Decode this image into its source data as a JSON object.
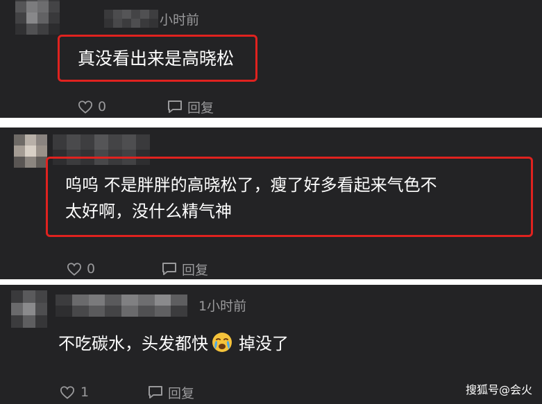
{
  "comments": [
    {
      "time": "小时前",
      "text_lines": [
        "真没看出来是高晓松"
      ],
      "likes": "0",
      "reply_label": "回复"
    },
    {
      "text_lines": [
        "呜呜 不是胖胖的高晓松了，瘦了好多看起来气色不",
        "太好啊，没什么精气神"
      ],
      "likes": "0",
      "reply_label": "回复"
    },
    {
      "time": "1小时前",
      "text_before_emoji": "不吃碳水，头发都快",
      "emoji": "crying-face-icon",
      "text_after_emoji": "掉没了",
      "likes": "1",
      "reply_label": "回复"
    }
  ],
  "watermark": "搜狐号@会火",
  "colors": {
    "panel": "#232325",
    "highlight": "#e0221f",
    "muted": "#9a9a9c"
  }
}
